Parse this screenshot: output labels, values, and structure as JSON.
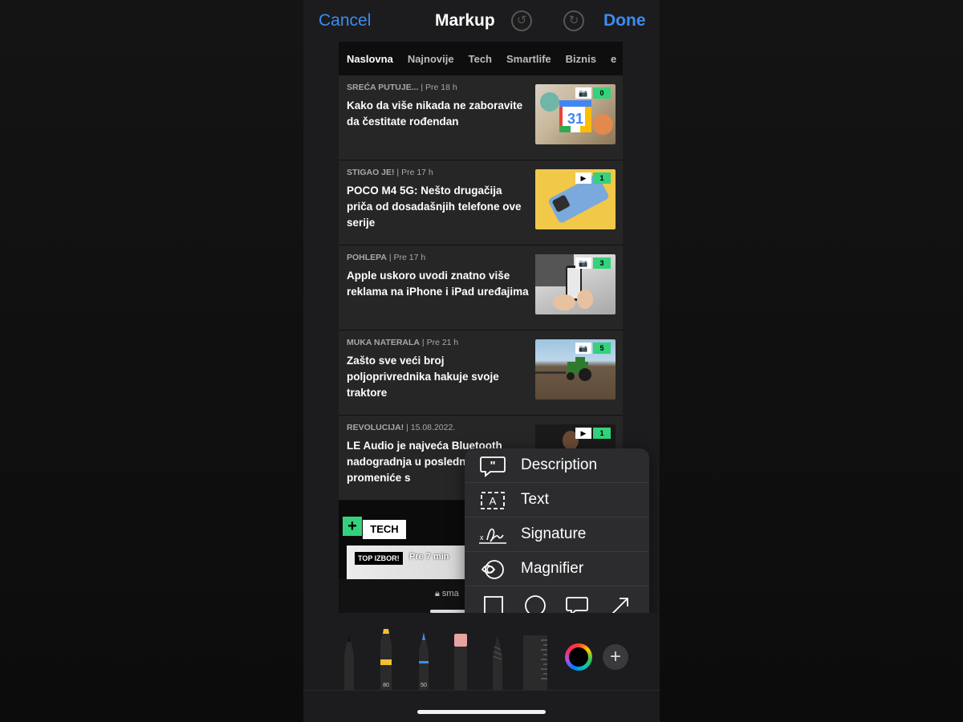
{
  "markup": {
    "cancel_label": "Cancel",
    "title": "Markup",
    "done_label": "Done",
    "undo_icon": "undo-icon",
    "redo_icon": "redo-icon"
  },
  "page": {
    "nav_items": [
      "Naslovna",
      "Najnovije",
      "Tech",
      "Smartlife",
      "Biznis",
      "e"
    ],
    "active_nav": "Naslovna",
    "articles": [
      {
        "category": "SREĆA PUTUJE...",
        "time": "Pre 18 h",
        "title": "Kako da više nikada ne zaboravite da čestitate rođendan",
        "media": "camera",
        "count": "0",
        "thumb_text": "31"
      },
      {
        "category": "STIGAO JE!",
        "time": "Pre 17 h",
        "title": "POCO M4 5G: Nešto drugačija priča od dosadašnjih telefone ove serije",
        "media": "play",
        "count": "1"
      },
      {
        "category": "POHLEPA",
        "time": "Pre 17 h",
        "title": "Apple uskoro uvodi znatno više reklama na iPhone i iPad uređajima",
        "media": "camera",
        "count": "3"
      },
      {
        "category": "MUKA NATERALA",
        "time": "Pre 21 h",
        "title": "Zašto sve veći broj poljoprivrednika hakuje svoje traktore",
        "media": "camera",
        "count": "5"
      },
      {
        "category": "REVOLUCIJA!",
        "time": "15.08.2022.",
        "title": "LE Audio je najveća Bluetooth nadogradnja u poslednj decenije i promeniće s",
        "media": "play",
        "count": "1"
      }
    ],
    "tech_label": "TECH",
    "top_izbor": "TOP IZBOR!",
    "tech_time": "Pre 7 min",
    "url_text": "sma"
  },
  "popup": {
    "items": [
      {
        "label": "Description",
        "icon": "quote-bubble-icon"
      },
      {
        "label": "Text",
        "icon": "text-box-icon"
      },
      {
        "label": "Signature",
        "icon": "signature-icon"
      },
      {
        "label": "Magnifier",
        "icon": "magnifier-icon"
      }
    ],
    "shapes": [
      "square-icon",
      "circle-icon",
      "speech-bubble-icon",
      "arrow-icon"
    ]
  },
  "tools": {
    "pen_icon": "pen-icon",
    "highlighter_icon": "highlighter-icon",
    "highlighter_value": "80",
    "pencil_icon": "pencil-icon",
    "pencil_value": "50",
    "eraser_icon": "eraser-icon",
    "lasso_icon": "lasso-icon",
    "ruler_icon": "ruler-icon",
    "color_picker_icon": "color-wheel-icon",
    "add_icon": "plus-icon",
    "add_label": "+"
  },
  "colors": {
    "accent": "#3d8cf0",
    "badge_green": "#34d27c"
  }
}
